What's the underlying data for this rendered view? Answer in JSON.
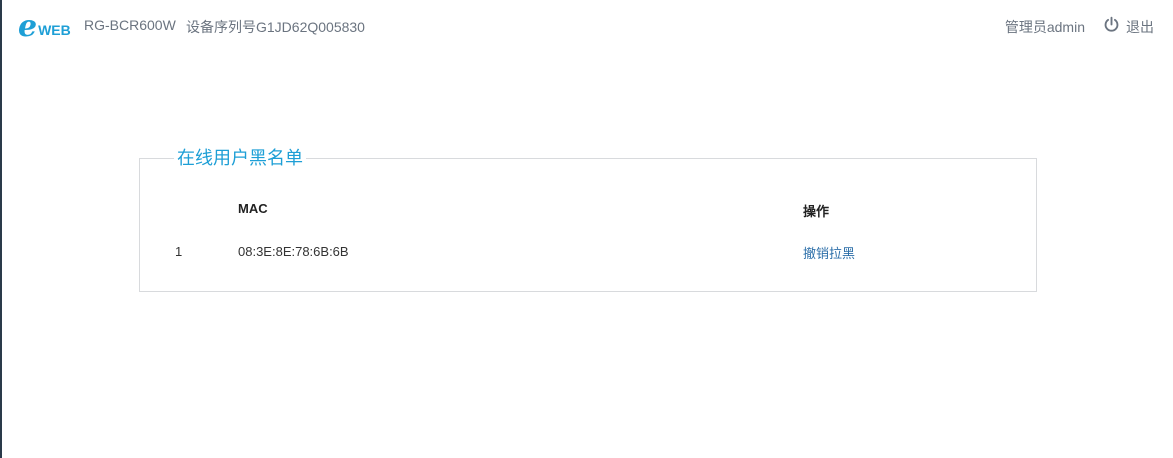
{
  "header": {
    "logo_letter": "e",
    "logo_text": "WEB",
    "model": "RG-BCR600W",
    "serial": "设备序列号G1JD62Q005830",
    "admin_label": "管理员admin",
    "logout_label": "退出",
    "logout_icon": "power-icon"
  },
  "blacklist": {
    "legend": "在线用户黑名单",
    "columns": {
      "mac": "MAC",
      "action": "操作"
    },
    "rows": [
      {
        "index": "1",
        "mac": "08:3E:8E:78:6B:6B",
        "action": "撤销拉黑"
      }
    ]
  },
  "colors": {
    "accent": "#1e9fd6",
    "link": "#2b6ea8",
    "muted_text": "#6b7480",
    "border": "#d8dadd"
  }
}
